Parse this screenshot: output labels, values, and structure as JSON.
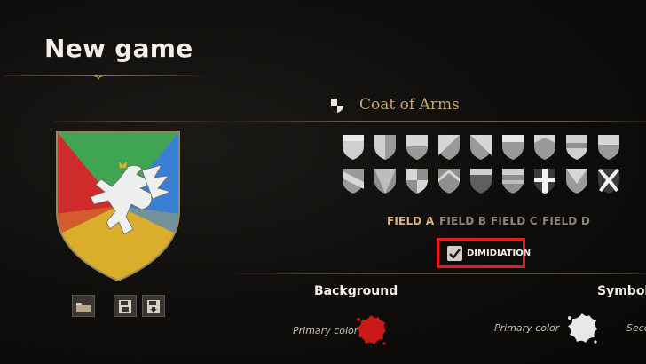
{
  "title": "New game",
  "section": {
    "title": "Coat of Arms",
    "icon": "quartered-shield-icon"
  },
  "preview": {
    "quarters": [
      "green",
      "blue",
      "red",
      "yellow"
    ],
    "charge": "white dragon"
  },
  "buttons": {
    "open": "folder-icon",
    "save": "save-icon",
    "load": "load-icon"
  },
  "patterns": [
    "plain",
    "per-pale",
    "per-fess",
    "per-bend",
    "per-bend-sinister",
    "chief",
    "chevron",
    "fess",
    "base",
    "bend",
    "per-saltire-left",
    "quarterly",
    "chevronel",
    "chief-band",
    "pale-band",
    "cross",
    "pile",
    "saltire"
  ],
  "fields": {
    "items": [
      "FIELD A",
      "FIELD B",
      "FIELD C",
      "FIELD D"
    ],
    "active": "FIELD A"
  },
  "dimidiation": {
    "label": "DIMIDIATION",
    "checked": true
  },
  "background": {
    "heading": "Background",
    "primary_label": "Primary color",
    "primary_color": "#cc1a1a"
  },
  "symbol": {
    "heading": "Symbol",
    "primary_label": "Primary color",
    "primary_color": "#e8e8e8",
    "secondary_label": "Secondary color"
  },
  "colors": {
    "accent": "#c8a36b",
    "highlight": "#e31e1e"
  }
}
